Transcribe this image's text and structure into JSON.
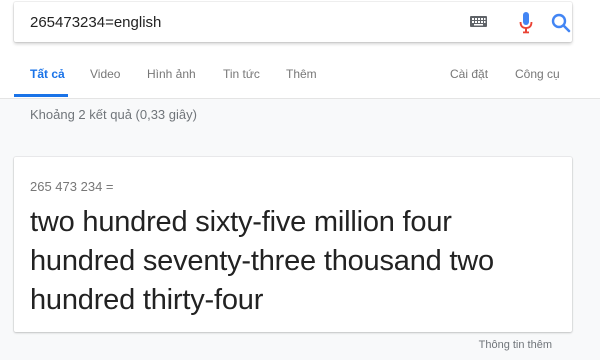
{
  "search": {
    "query": "265473234=english"
  },
  "icons": {
    "keyboard": "keyboard-icon",
    "mic": "microphone-icon",
    "search": "search-icon"
  },
  "colors": {
    "accent": "#1a73e8",
    "mic_blue": "#4285f4",
    "mic_red": "#ea4335"
  },
  "tabs": {
    "all": "Tất cả",
    "video": "Video",
    "images": "Hình ảnh",
    "news": "Tin tức",
    "more": "Thêm",
    "settings": "Cài đặt",
    "tools": "Công cụ"
  },
  "result_stats": "Khoảng 2 kết quả (0,33 giây)",
  "calculator": {
    "equation": "265 473 234 =",
    "answer": "two hundred sixty-five million four hundred seventy-three thousand two hundred thirty-four"
  },
  "footer": {
    "more_info": "Thông tin thêm"
  }
}
